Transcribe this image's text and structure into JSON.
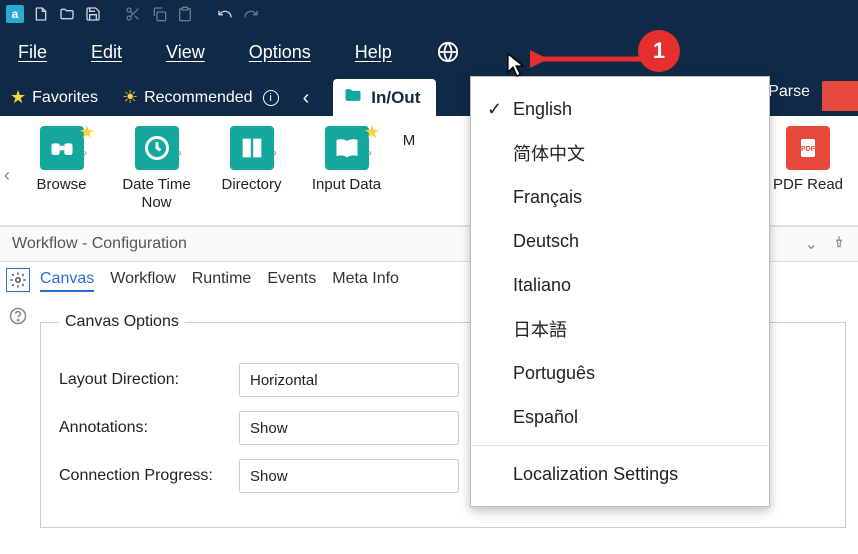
{
  "titlebar": {
    "app_letter": "a"
  },
  "menubar": {
    "file": "File",
    "edit": "Edit",
    "view": "View",
    "options": "Options",
    "help": "Help"
  },
  "ribbon": {
    "favorites": "Favorites",
    "recommended": "Recommended",
    "active_tab": "In/Out",
    "parse": "Parse"
  },
  "tools": {
    "browse": "Browse",
    "datetime": "Date Time Now",
    "directory": "Directory",
    "inputdata": "Input Data",
    "m": "M",
    "pdfread": "PDF Read"
  },
  "config": {
    "header": "Workflow - Configuration",
    "tabs": {
      "canvas": "Canvas",
      "workflow": "Workflow",
      "runtime": "Runtime",
      "events": "Events",
      "meta": "Meta Info"
    },
    "fieldset": "Canvas Options",
    "rows": {
      "layout_label": "Layout Direction:",
      "layout_value": "Horizontal",
      "annotations_label": "Annotations:",
      "annotations_value": "Show",
      "connprog_label": "Connection Progress:",
      "connprog_value": "Show"
    }
  },
  "language_menu": {
    "items": [
      {
        "label": "English",
        "checked": true
      },
      {
        "label": "简体中文",
        "checked": false
      },
      {
        "label": "Français",
        "checked": false
      },
      {
        "label": "Deutsch",
        "checked": false
      },
      {
        "label": "Italiano",
        "checked": false
      },
      {
        "label": "日本語",
        "checked": false
      },
      {
        "label": "Português",
        "checked": false
      },
      {
        "label": "Español",
        "checked": false
      }
    ],
    "settings": "Localization Settings"
  },
  "annotation": {
    "badge": "1"
  }
}
